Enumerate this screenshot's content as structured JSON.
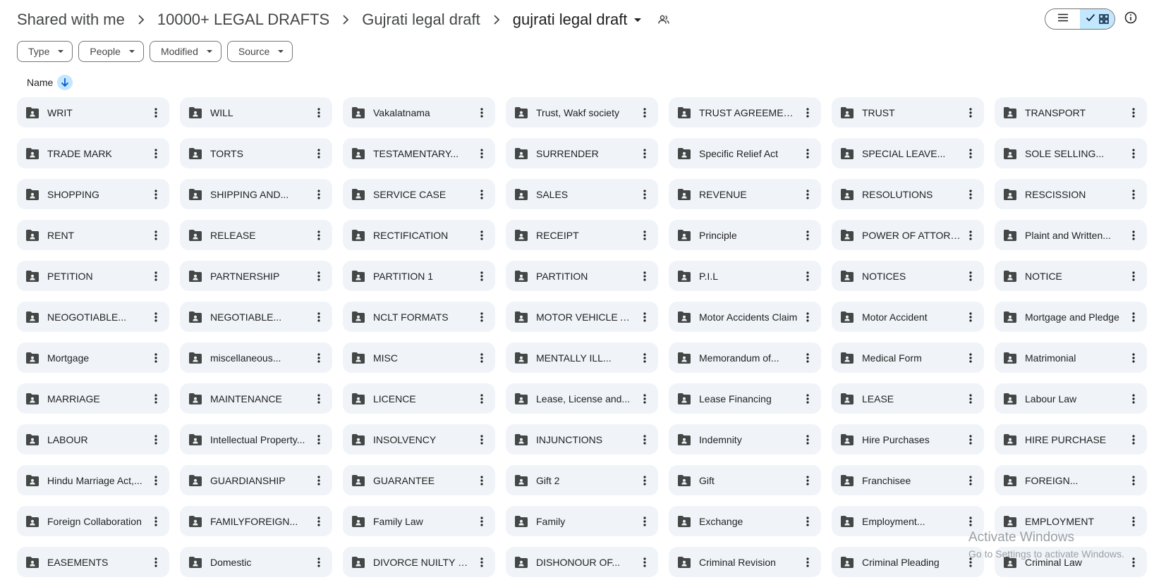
{
  "breadcrumbs": [
    "Shared with me",
    "10000+ LEGAL DRAFTS",
    "Gujrati legal draft"
  ],
  "current_folder": "gujrati legal draft",
  "filters": [
    "Type",
    "People",
    "Modified",
    "Source"
  ],
  "sort": {
    "label": "Name",
    "direction": "ascending-arrow"
  },
  "icons": {
    "folder": "shared-folder-icon",
    "more": "more-vert-icon",
    "list_view": "list-view-icon",
    "grid_view": "grid-view-icon",
    "info": "info-icon",
    "share": "people-icon"
  },
  "colors": {
    "card_bg": "#f0f4f9",
    "active_toggle": "#c2e7ff",
    "icon": "#444746",
    "text": "#1f1f1f"
  },
  "folders": [
    "WRIT",
    "WILL",
    "Vakalatnama",
    "Trust, Wakf society",
    "TRUST AGREEMENTS",
    "TRUST",
    "TRANSPORT",
    "TRADE MARK",
    "TORTS",
    "TESTAMENTARY...",
    "SURRENDER",
    "Specific Relief Act",
    "SPECIAL LEAVE...",
    "SOLE SELLING...",
    "SHOPPING",
    "SHIPPING AND...",
    "SERVICE CASE",
    "SALES",
    "REVENUE",
    "RESOLUTIONS",
    "RESCISSION",
    "RENT",
    "RELEASE",
    "RECTIFICATION",
    "RECEIPT",
    "Principle",
    "POWER OF ATTORNEY",
    "Plaint and Written...",
    "PETITION",
    "PARTNERSHIP",
    "PARTITION 1",
    "PARTITION",
    "P.I.L",
    "NOTICES",
    "NOTICE",
    "NEOGOTIABLE...",
    "NEGOTIABLE...",
    "NCLT FORMATS",
    "MOTOR VEHICLE ACT",
    "Motor Accidents Claim",
    "Motor Accident",
    "Mortgage and Pledge",
    "Mortgage",
    "miscellaneous...",
    "MISC",
    "MENTALLY ILL...",
    "Memorandum of...",
    "Medical Form",
    "Matrimonial",
    "MARRIAGE",
    "MAINTENANCE",
    "LICENCE",
    "Lease, License and...",
    "Lease Financing",
    "LEASE",
    "Labour Law",
    "LABOUR",
    "Intellectual Property...",
    "INSOLVENCY",
    "INJUNCTIONS",
    "Indemnity",
    "Hire Purchases",
    "HIRE PURCHASE",
    "Hindu Marriage Act,...",
    "GUARDIANSHIP",
    "GUARANTEE",
    "Gift 2",
    "Gift",
    "Franchisee",
    "FOREIGN...",
    "Foreign Collaboration",
    "FAMILYFOREIGN...",
    "Family Law",
    "Family",
    "Exchange",
    "Employment...",
    "EMPLOYMENT",
    "EASEMENTS",
    "Domestic",
    "DIVORCE NUILTY OF...",
    "DISHONOUR OF...",
    "Criminal Revision",
    "Criminal Pleading",
    "Criminal Law"
  ],
  "watermark": {
    "line1": "Activate Windows",
    "line2": "Go to Settings to activate Windows."
  }
}
